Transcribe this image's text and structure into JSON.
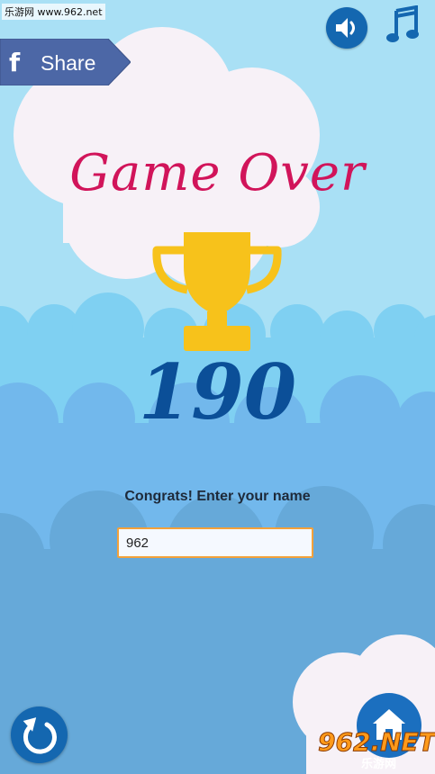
{
  "watermark_top": "乐游网 www.962.net",
  "share": {
    "icon": "facebook-icon",
    "label": "Share"
  },
  "controls": {
    "sound_icon": "speaker-icon",
    "music_icon": "music-note-icon",
    "restart_icon": "restart-arrow-icon",
    "home_icon": "home-icon"
  },
  "title": "Game Over",
  "trophy_icon": "trophy-icon",
  "score": "190",
  "prompt": "Congrats! Enter your name",
  "name_input": {
    "value": "962"
  },
  "watermark_bottom": {
    "main": "962.NET",
    "sub": "乐游网"
  },
  "colors": {
    "sky": "#a9e0f5",
    "cloud": "#f7f1f7",
    "title": "#d1145a",
    "score": "#0b4f98",
    "trophy": "#f7c21b",
    "button": "#1467b0",
    "input_border": "#f3a13a"
  }
}
